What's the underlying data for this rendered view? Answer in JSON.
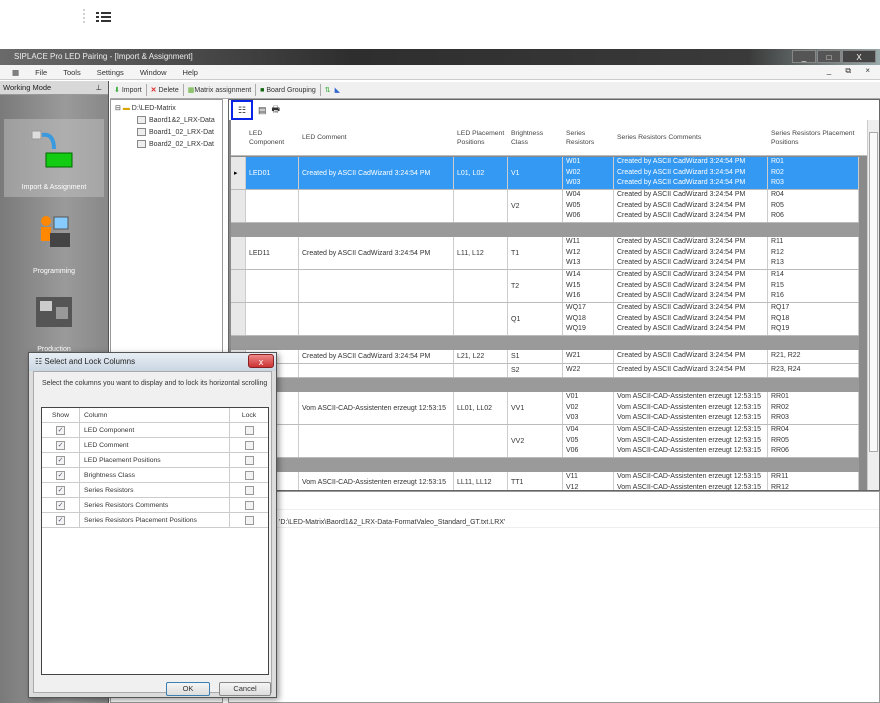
{
  "window": {
    "title": "SIPLACE Pro LED Pairing - [Import & Assignment]",
    "controls": [
      "_",
      "□",
      "X"
    ]
  },
  "menu": [
    "File",
    "Tools",
    "Settings",
    "Window",
    "Help"
  ],
  "mdi_controls": "_ ⧉ ×",
  "working_mode": {
    "title": "Working Mode",
    "pin": "⊥",
    "modes": [
      {
        "label": "Import & Assignment",
        "selected": true
      },
      {
        "label": "Programming",
        "selected": false
      },
      {
        "label": "Production",
        "selected": false
      }
    ]
  },
  "toolbar": {
    "import": "Import",
    "delete": "Delete",
    "matrix": "Matrix assignment",
    "grouping": "Board Grouping"
  },
  "tree": {
    "root": "D:\\LED-Matrix",
    "items": [
      "Baord1&2_LRX-Data",
      "Board1_02_LRX-Dat",
      "Board2_02_LRX-Dat"
    ]
  },
  "grid": {
    "columns": [
      "LED Component",
      "LED Comment",
      "LED Placement Positions",
      "Brightness Class",
      "Series Resistors",
      "Series Resistors Comments",
      "Series Resistors Placement Positions"
    ],
    "groups": [
      {
        "component": "LED01",
        "comment": "Created by ASCII CadWizard 3:24:54 PM",
        "positions": "L01, L02",
        "selected": true,
        "classes": [
          {
            "cls": "V1",
            "res": [
              "W01",
              "W02",
              "W03"
            ],
            "comments": [
              "Created by ASCII CadWizard 3:24:54 PM",
              "Created by ASCII CadWizard 3:24:54 PM",
              "Created by ASCII CadWizard 3:24:54 PM"
            ],
            "pos": [
              "R01",
              "R02",
              "R03"
            ]
          },
          {
            "cls": "V2",
            "res": [
              "W04",
              "W05",
              "W06"
            ],
            "comments": [
              "Created by ASCII CadWizard 3:24:54 PM",
              "Created by ASCII CadWizard 3:24:54 PM",
              "Created by ASCII CadWizard 3:24:54 PM"
            ],
            "pos": [
              "R04",
              "R05",
              "R06"
            ]
          }
        ]
      },
      {
        "component": "LED11",
        "comment": "Created by ASCII CadWizard 3:24:54 PM",
        "positions": "L11, L12",
        "classes": [
          {
            "cls": "T1",
            "res": [
              "W11",
              "W12",
              "W13"
            ],
            "comments": [
              "Created by ASCII CadWizard 3:24:54 PM",
              "Created by ASCII CadWizard 3:24:54 PM",
              "Created by ASCII CadWizard 3:24:54 PM"
            ],
            "pos": [
              "R11",
              "R12",
              "R13"
            ]
          },
          {
            "cls": "T2",
            "res": [
              "W14",
              "W15",
              "W16"
            ],
            "comments": [
              "Created by ASCII CadWizard 3:24:54 PM",
              "Created by ASCII CadWizard 3:24:54 PM",
              "Created by ASCII CadWizard 3:24:54 PM"
            ],
            "pos": [
              "R14",
              "R15",
              "R16"
            ]
          },
          {
            "cls": "Q1",
            "res": [
              "WQ17",
              "WQ18",
              "WQ19"
            ],
            "comments": [
              "Created by ASCII CadWizard 3:24:54 PM",
              "Created by ASCII CadWizard 3:24:54 PM",
              "Created by ASCII CadWizard 3:24:54 PM"
            ],
            "pos": [
              "RQ17",
              "RQ18",
              "RQ19"
            ]
          }
        ]
      },
      {
        "component": "",
        "comment": "Created by ASCII CadWizard 3:24:54 PM",
        "positions": "L21, L22",
        "classes": [
          {
            "cls": "S1",
            "res": [
              "W21"
            ],
            "comments": [
              "Created by ASCII CadWizard 3:24:54 PM"
            ],
            "pos": [
              "R21, R22"
            ]
          },
          {
            "cls": "S2",
            "res": [
              "W22"
            ],
            "comments": [
              "Created by ASCII CadWizard 3:24:54 PM"
            ],
            "pos": [
              "R23, R24"
            ]
          }
        ]
      },
      {
        "component": "",
        "comment": "Vom ASCII-CAD-Assistenten erzeugt 12:53:15",
        "positions": "LL01, LL02",
        "classes": [
          {
            "cls": "VV1",
            "res": [
              "V01",
              "V02",
              "V03"
            ],
            "comments": [
              "Vom ASCII-CAD-Assistenten erzeugt 12:53:15",
              "Vom ASCII-CAD-Assistenten erzeugt 12:53:15",
              "Vom ASCII-CAD-Assistenten erzeugt 12:53:15"
            ],
            "pos": [
              "RR01",
              "RR02",
              "RR03"
            ]
          },
          {
            "cls": "VV2",
            "res": [
              "V04",
              "V05",
              "V06"
            ],
            "comments": [
              "Vom ASCII-CAD-Assistenten erzeugt 12:53:15",
              "Vom ASCII-CAD-Assistenten erzeugt 12:53:15",
              "Vom ASCII-CAD-Assistenten erzeugt 12:53:15"
            ],
            "pos": [
              "RR04",
              "RR05",
              "RR06"
            ]
          }
        ]
      },
      {
        "component": "",
        "comment": "Vom ASCII-CAD-Assistenten erzeugt 12:53:15",
        "positions": "LL11, LL12",
        "classes": [
          {
            "cls": "TT1",
            "res": [
              "V11",
              "V12"
            ],
            "comments": [
              "Vom ASCII-CAD-Assistenten erzeugt 12:53:15",
              "Vom ASCII-CAD-Assistenten erzeugt 12:53:15"
            ],
            "pos": [
              "RR11",
              "RR12"
            ]
          }
        ]
      }
    ]
  },
  "log": {
    "path": "'D:\\LED-Matrix\\Baord1&2_LRX-Data-FormatValeo_Standard_GT.txt.LRX'"
  },
  "dialog": {
    "title": "Select and Lock Columns",
    "description": "Select the columns you want to display and to lock its horizontal scrolling",
    "headers": {
      "show": "Show",
      "column": "Column",
      "lock": "Lock"
    },
    "rows": [
      {
        "name": "LED Component",
        "show": true,
        "lock": false
      },
      {
        "name": "LED Comment",
        "show": true,
        "lock": false
      },
      {
        "name": "LED Placement Positions",
        "show": true,
        "lock": false
      },
      {
        "name": "Brightness Class",
        "show": true,
        "lock": false
      },
      {
        "name": "Series Resistors",
        "show": true,
        "lock": false
      },
      {
        "name": "Series Resistors Comments",
        "show": true,
        "lock": false
      },
      {
        "name": "Series Resistors Placement Positions",
        "show": true,
        "lock": false
      }
    ],
    "ok": "OK",
    "cancel": "Cancel",
    "close": "x"
  }
}
